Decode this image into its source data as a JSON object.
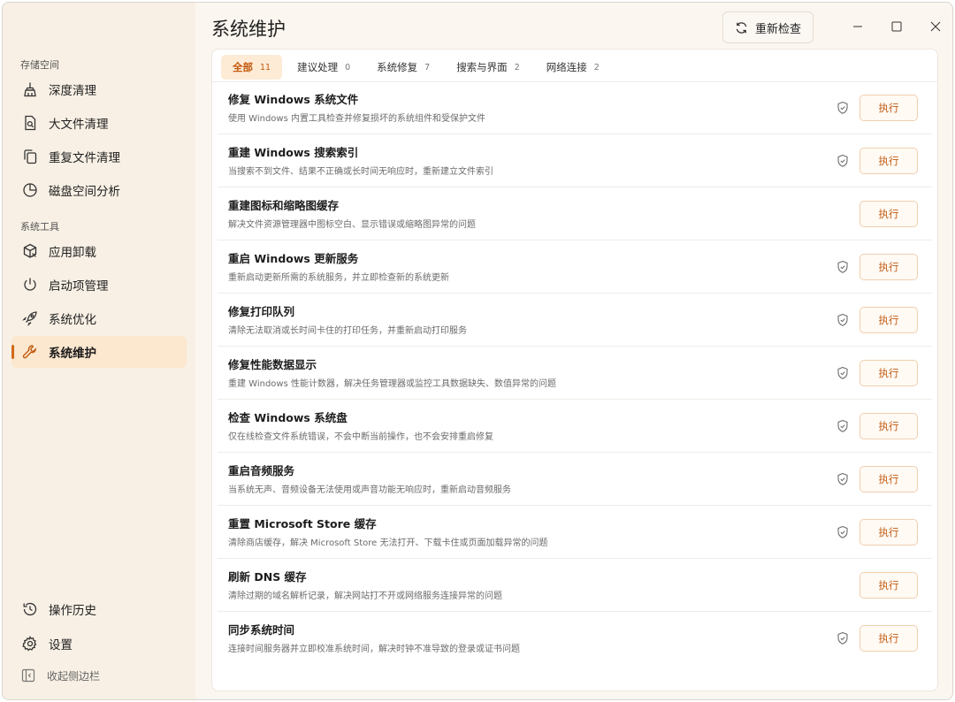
{
  "window": {
    "title": "系统维护"
  },
  "sidebar": {
    "storage_section": "存储空间",
    "tools_section": "系统工具",
    "storage_items": [
      {
        "label": "深度清理",
        "icon": "broom-icon"
      },
      {
        "label": "大文件清理",
        "icon": "file-search-icon"
      },
      {
        "label": "重复文件清理",
        "icon": "copy-icon"
      },
      {
        "label": "磁盘空间分析",
        "icon": "pie-chart-icon"
      }
    ],
    "tool_items": [
      {
        "label": "应用卸载",
        "icon": "package-icon"
      },
      {
        "label": "启动项管理",
        "icon": "power-icon"
      },
      {
        "label": "系统优化",
        "icon": "rocket-icon"
      },
      {
        "label": "系统维护",
        "icon": "wrench-icon",
        "active": true
      }
    ],
    "bottom_items": [
      {
        "label": "操作历史",
        "icon": "history-icon"
      },
      {
        "label": "设置",
        "icon": "gear-icon"
      }
    ],
    "collapse_label": "收起侧边栏"
  },
  "header": {
    "recheck_label": "重新检查"
  },
  "tabs": [
    {
      "label": "全部",
      "count": "11",
      "active": true
    },
    {
      "label": "建议处理",
      "count": "0"
    },
    {
      "label": "系统修复",
      "count": "7"
    },
    {
      "label": "搜索与界面",
      "count": "2"
    },
    {
      "label": "网络连接",
      "count": "2"
    }
  ],
  "tasks": [
    {
      "title": "修复 Windows 系统文件",
      "desc": "使用 Windows 内置工具检查并修复损坏的系统组件和受保护文件",
      "admin": true,
      "action": "执行"
    },
    {
      "title": "重建 Windows 搜索索引",
      "desc": "当搜索不到文件、结果不正确或长时间无响应时，重新建立文件索引",
      "admin": true,
      "action": "执行"
    },
    {
      "title": "重建图标和缩略图缓存",
      "desc": "解决文件资源管理器中图标空白、显示错误或缩略图异常的问题",
      "admin": false,
      "action": "执行"
    },
    {
      "title": "重启 Windows 更新服务",
      "desc": "重新启动更新所需的系统服务，并立即检查新的系统更新",
      "admin": true,
      "action": "执行"
    },
    {
      "title": "修复打印队列",
      "desc": "清除无法取消或长时间卡住的打印任务，并重新启动打印服务",
      "admin": true,
      "action": "执行"
    },
    {
      "title": "修复性能数据显示",
      "desc": "重建 Windows 性能计数器，解决任务管理器或监控工具数据缺失、数值异常的问题",
      "admin": true,
      "action": "执行"
    },
    {
      "title": "检查 Windows 系统盘",
      "desc": "仅在线检查文件系统错误，不会中断当前操作，也不会安排重启修复",
      "admin": true,
      "action": "执行"
    },
    {
      "title": "重启音频服务",
      "desc": "当系统无声、音频设备无法使用或声音功能无响应时，重新启动音频服务",
      "admin": true,
      "action": "执行"
    },
    {
      "title": "重置 Microsoft Store 缓存",
      "desc": "清除商店缓存，解决 Microsoft Store 无法打开、下载卡住或页面加载异常的问题",
      "admin": true,
      "action": "执行"
    },
    {
      "title": "刷新 DNS 缓存",
      "desc": "清除过期的域名解析记录，解决网站打不开或网络服务连接异常的问题",
      "admin": false,
      "action": "执行"
    },
    {
      "title": "同步系统时间",
      "desc": "连接时间服务器并立即校准系统时间，解决时钟不准导致的登录或证书问题",
      "admin": true,
      "action": "执行"
    }
  ],
  "colors": {
    "accent": "#c25a0f",
    "active_bg": "#fce7cf",
    "sidebar_bg": "#f8f0e5"
  }
}
